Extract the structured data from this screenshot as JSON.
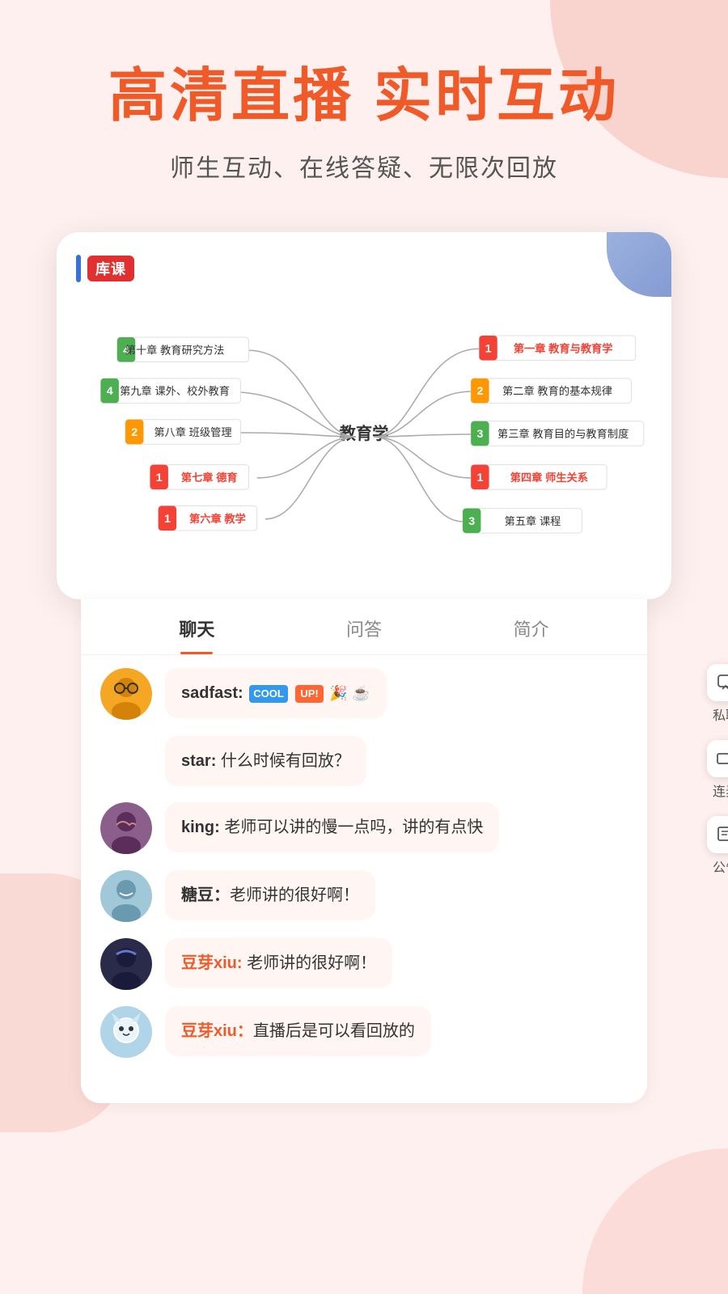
{
  "hero": {
    "title": "高清直播  实时互动",
    "subtitle": "师生互动、在线答疑、无限次回放"
  },
  "mindmap": {
    "logo_text": "库课",
    "center": "教育学",
    "left_nodes": [
      {
        "num": "4",
        "num_color": "#4caf50",
        "text": "第十章 教育研究方法"
      },
      {
        "num": "4",
        "num_color": "#4caf50",
        "text": "第九章 课外、校外教育"
      },
      {
        "num": "2",
        "num_color": "#ff9800",
        "text": "第八章 班级管理"
      },
      {
        "num": "1",
        "num_color": "#f44336",
        "text": "第七章 德育"
      },
      {
        "num": "1",
        "num_color": "#f44336",
        "text": "第六章 教学"
      }
    ],
    "right_nodes": [
      {
        "num": "1",
        "num_color": "#f44336",
        "text": "第一章 教育与教育学",
        "bold": true
      },
      {
        "num": "2",
        "num_color": "#ff9800",
        "text": "第二章 教育的基本规律"
      },
      {
        "num": "3",
        "num_color": "#4caf50",
        "text": "第三章 教育目的与教育制度"
      },
      {
        "num": "1",
        "num_color": "#f44336",
        "text": "第四章 师生关系",
        "bold": true
      },
      {
        "num": "3",
        "num_color": "#4caf50",
        "text": "第五章 课程"
      }
    ]
  },
  "tabs": [
    {
      "label": "聊天",
      "active": true
    },
    {
      "label": "问答",
      "active": false
    },
    {
      "label": "简介",
      "active": false
    }
  ],
  "chat_messages": [
    {
      "id": "msg1",
      "has_avatar": true,
      "avatar_type": "person1",
      "sender": "sadfast",
      "sender_colored": true,
      "text_parts": [
        "badges",
        " "
      ],
      "badges": [
        "COOL",
        "UP!",
        "🎉",
        "☕"
      ],
      "full_text": "sadfast: "
    },
    {
      "id": "msg2",
      "has_avatar": false,
      "sender": "star",
      "sender_colored": false,
      "full_text": "star: 什么时候有回放？"
    },
    {
      "id": "msg3",
      "has_avatar": true,
      "avatar_type": "person2",
      "sender": "king",
      "sender_colored": false,
      "full_text": "king: 老师可以讲的慢一点吗，讲的有点快"
    },
    {
      "id": "msg4",
      "has_avatar": true,
      "avatar_type": "person3",
      "sender": "糖豆",
      "sender_colored": false,
      "full_text": "糖豆：老师讲的很好啊！"
    },
    {
      "id": "msg5",
      "has_avatar": true,
      "avatar_type": "person4",
      "sender": "豆芽xiu",
      "sender_colored": true,
      "full_text": "豆芽xiu: 老师讲的很好啊！"
    },
    {
      "id": "msg6",
      "has_avatar": true,
      "avatar_type": "person5",
      "sender": "豆芽xiu",
      "sender_colored": true,
      "full_text": "豆芽xiu：直播后是可以看回放的"
    }
  ],
  "action_buttons": [
    {
      "label": "私聊",
      "icon": "chat-icon"
    },
    {
      "label": "连麦",
      "icon": "video-icon"
    },
    {
      "label": "公告",
      "icon": "notice-icon"
    }
  ],
  "colors": {
    "primary": "#f05a28",
    "accent_blue": "#3a6fd8",
    "accent_green": "#4caf50",
    "accent_orange": "#ff9800",
    "accent_red": "#f44336",
    "bg": "#fdf0ee"
  }
}
